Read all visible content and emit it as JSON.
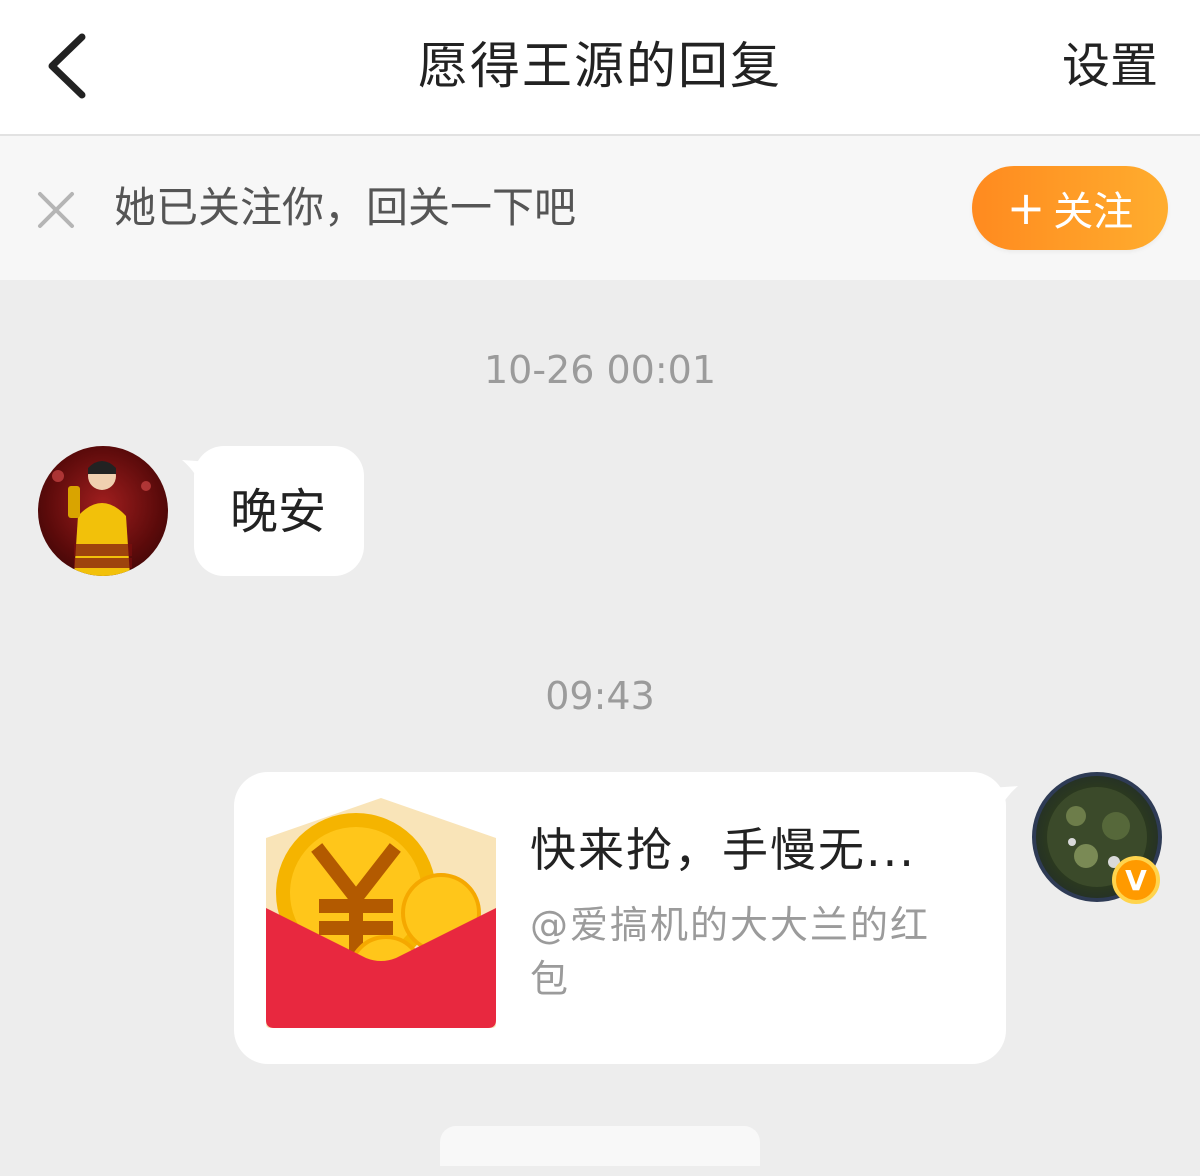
{
  "header": {
    "title": "愿得王源的回复",
    "settings_label": "设置",
    "back_icon": "chevron-left-icon"
  },
  "follow_bar": {
    "text": "她已关注你，回关一下吧",
    "button_plus": "+",
    "button_label": "关注",
    "close_icon": "close-icon",
    "button_color": "#ff9a24"
  },
  "messages": [
    {
      "timestamp": "10-26 00:01",
      "sender": "other",
      "type": "text",
      "text": "晚安"
    },
    {
      "timestamp": "09:43",
      "sender": "self",
      "type": "red-packet",
      "title": "快来抢，手慢无...",
      "subtitle": "@爱搞机的大大兰的红包",
      "verified": true,
      "badge_letter": "V"
    }
  ],
  "colors": {
    "background": "#ededed",
    "red_packet": "#e8283f",
    "coin": "#f5b400",
    "follow_button": "#ff9a24"
  }
}
